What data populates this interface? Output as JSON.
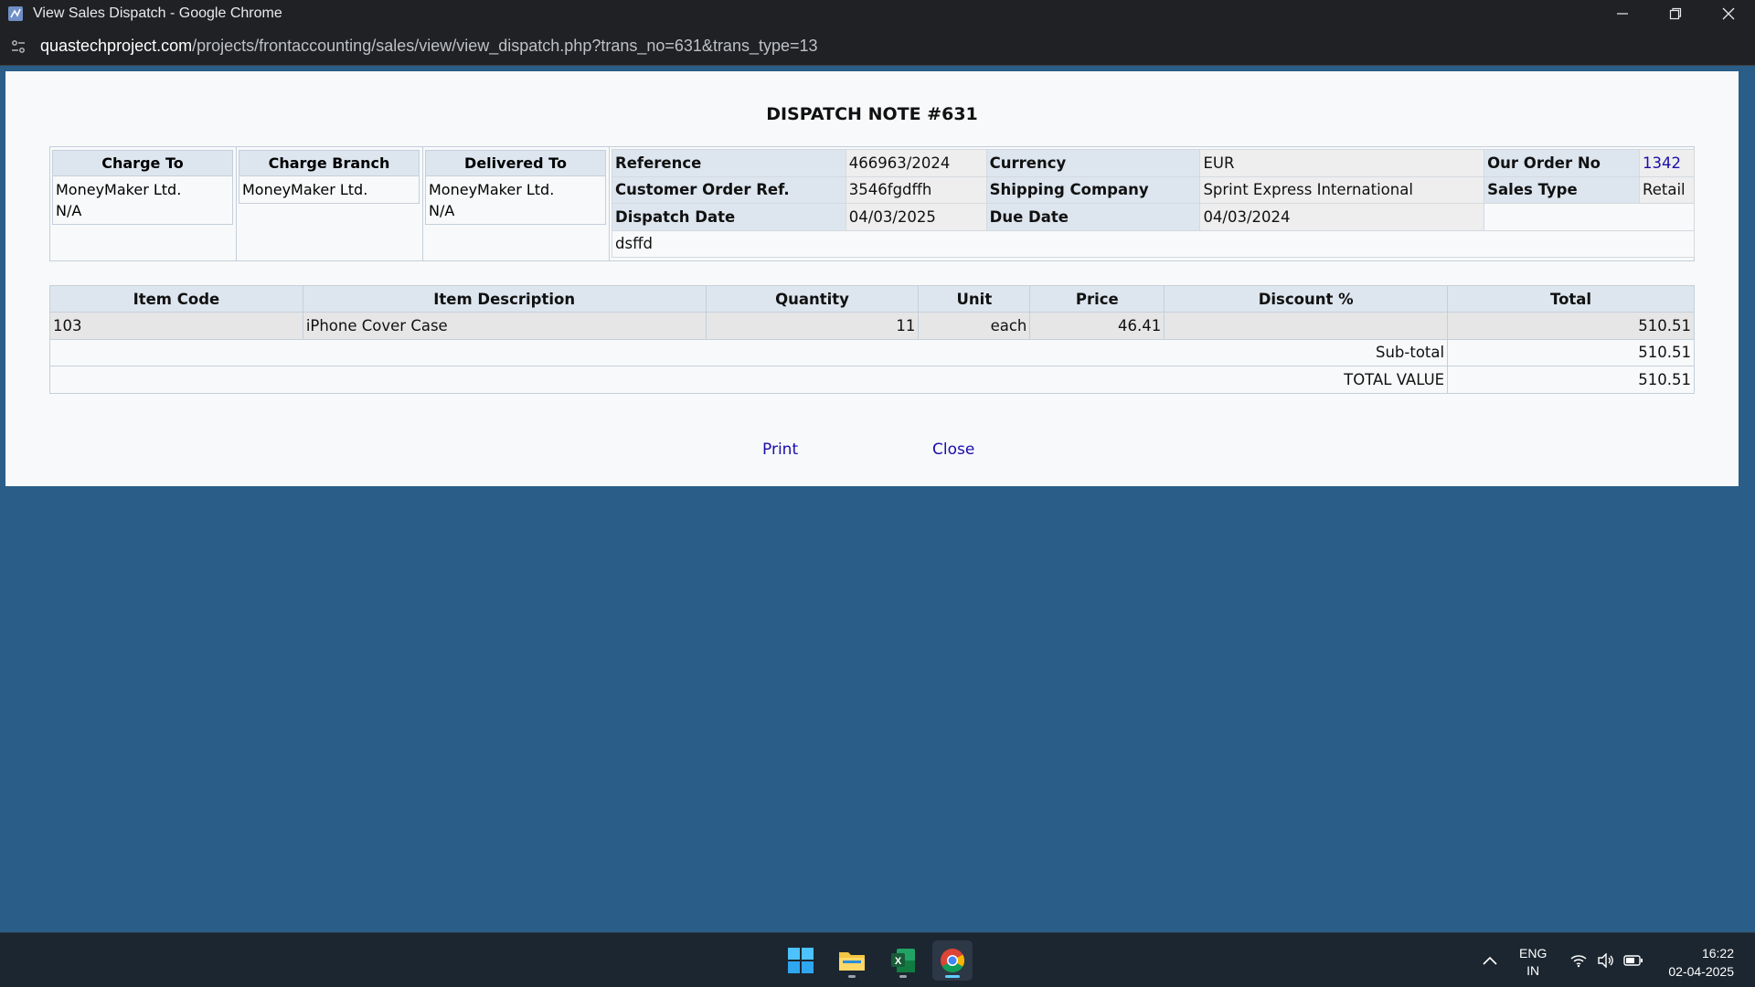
{
  "window": {
    "title": "View Sales Dispatch - Google Chrome",
    "url_host": "quastechproject.com",
    "url_path": "/projects/frontaccounting/sales/view/view_dispatch.php?trans_no=631&trans_type=13"
  },
  "document": {
    "title": "DISPATCH NOTE #631",
    "charge_to": {
      "header": "Charge To",
      "line1": "MoneyMaker Ltd.",
      "line2": "N/A"
    },
    "charge_branch": {
      "header": "Charge Branch",
      "line1": "MoneyMaker Ltd."
    },
    "delivered_to": {
      "header": "Delivered To",
      "line1": "MoneyMaker Ltd.",
      "line2": "N/A"
    },
    "info": {
      "reference_label": "Reference",
      "reference": "466963/2024",
      "currency_label": "Currency",
      "currency": "EUR",
      "order_no_label": "Our Order No",
      "order_no": "1342",
      "customer_ref_label": "Customer Order Ref.",
      "customer_ref": "3546fgdffh",
      "shipping_label": "Shipping Company",
      "shipping": "Sprint Express International",
      "sales_type_label": "Sales Type",
      "sales_type": "Retail",
      "dispatch_date_label": "Dispatch Date",
      "dispatch_date": "04/03/2025",
      "due_date_label": "Due Date",
      "due_date": "04/03/2024",
      "memo": "dsffd"
    },
    "items": {
      "headers": [
        "Item Code",
        "Item Description",
        "Quantity",
        "Unit",
        "Price",
        "Discount %",
        "Total"
      ],
      "rows": [
        {
          "code": "103",
          "description": "iPhone Cover Case",
          "quantity": "11",
          "unit": "each",
          "price": "46.41",
          "discount": "",
          "total": "510.51"
        }
      ],
      "subtotal_label": "Sub-total",
      "subtotal": "510.51",
      "total_label": "TOTAL VALUE",
      "total": "510.51"
    },
    "actions": {
      "print": "Print",
      "close": "Close"
    }
  },
  "taskbar": {
    "lang_top": "ENG",
    "lang_bottom": "IN",
    "time": "16:22",
    "date": "02-04-2025"
  },
  "colors": {
    "desktop": "#2a5d88",
    "header_cell": "#dde6ef",
    "link": "#1a0dab"
  }
}
